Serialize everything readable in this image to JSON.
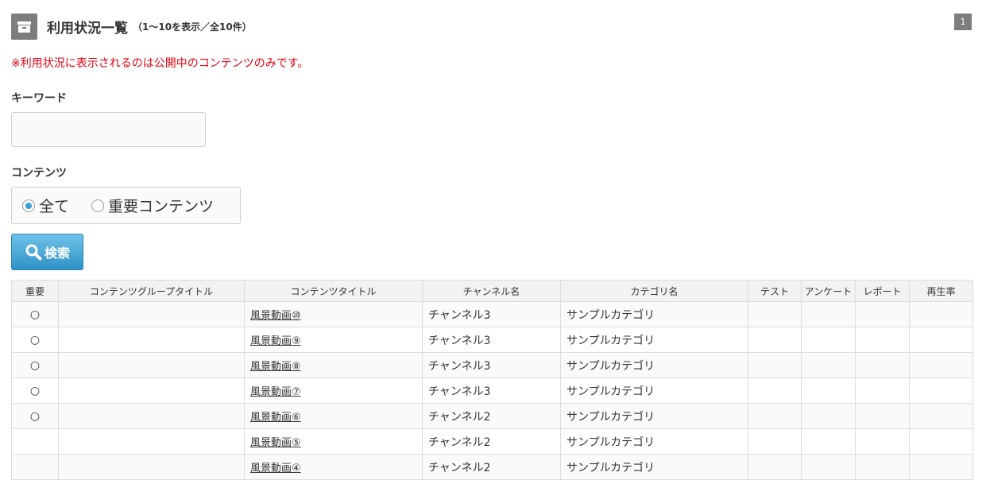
{
  "header": {
    "icon": "archive-box-icon",
    "title": "利用状況一覧",
    "subtitle": "（1～10を表示／全10件）",
    "page": "1"
  },
  "notice": "※利用状況に表示されるのは公開中のコンテンツのみです。",
  "keyword": {
    "label": "キーワード",
    "value": "",
    "placeholder": ""
  },
  "content_filter": {
    "label": "コンテンツ",
    "options": [
      {
        "label": "全て",
        "selected": true
      },
      {
        "label": "重要コンテンツ",
        "selected": false
      }
    ]
  },
  "search_button": {
    "label": "検索",
    "icon": "magnifier-icon",
    "color": "#3a9fd1"
  },
  "table": {
    "columns": [
      "重要",
      "コンテンツグループタイトル",
      "コンテンツタイトル",
      "チャンネル名",
      "カテゴリ名",
      "テスト",
      "アンケート",
      "レポート",
      "再生率"
    ],
    "rows": [
      {
        "important": "○",
        "group": "",
        "title": "風景動画⑩",
        "channel": "チャンネル3",
        "category": "サンプルカテゴリ",
        "test": "",
        "survey": "",
        "report": "",
        "rate": ""
      },
      {
        "important": "○",
        "group": "",
        "title": "風景動画⑨",
        "channel": "チャンネル3",
        "category": "サンプルカテゴリ",
        "test": "",
        "survey": "",
        "report": "",
        "rate": ""
      },
      {
        "important": "○",
        "group": "",
        "title": "風景動画⑧",
        "channel": "チャンネル3",
        "category": "サンプルカテゴリ",
        "test": "",
        "survey": "",
        "report": "",
        "rate": ""
      },
      {
        "important": "○",
        "group": "",
        "title": "風景動画⑦",
        "channel": "チャンネル3",
        "category": "サンプルカテゴリ",
        "test": "",
        "survey": "",
        "report": "",
        "rate": ""
      },
      {
        "important": "○",
        "group": "",
        "title": "風景動画⑥",
        "channel": "チャンネル2",
        "category": "サンプルカテゴリ",
        "test": "",
        "survey": "",
        "report": "",
        "rate": ""
      },
      {
        "important": "",
        "group": "",
        "title": "風景動画⑤",
        "channel": "チャンネル2",
        "category": "サンプルカテゴリ",
        "test": "",
        "survey": "",
        "report": "",
        "rate": ""
      },
      {
        "important": "",
        "group": "",
        "title": "風景動画④",
        "channel": "チャンネル2",
        "category": "サンプルカテゴリ",
        "test": "",
        "survey": "",
        "report": "",
        "rate": ""
      }
    ]
  },
  "colors": {
    "notice": "#e60012",
    "header_icon": "#7d7d7d",
    "radio_selected": "#3aa1d8"
  }
}
